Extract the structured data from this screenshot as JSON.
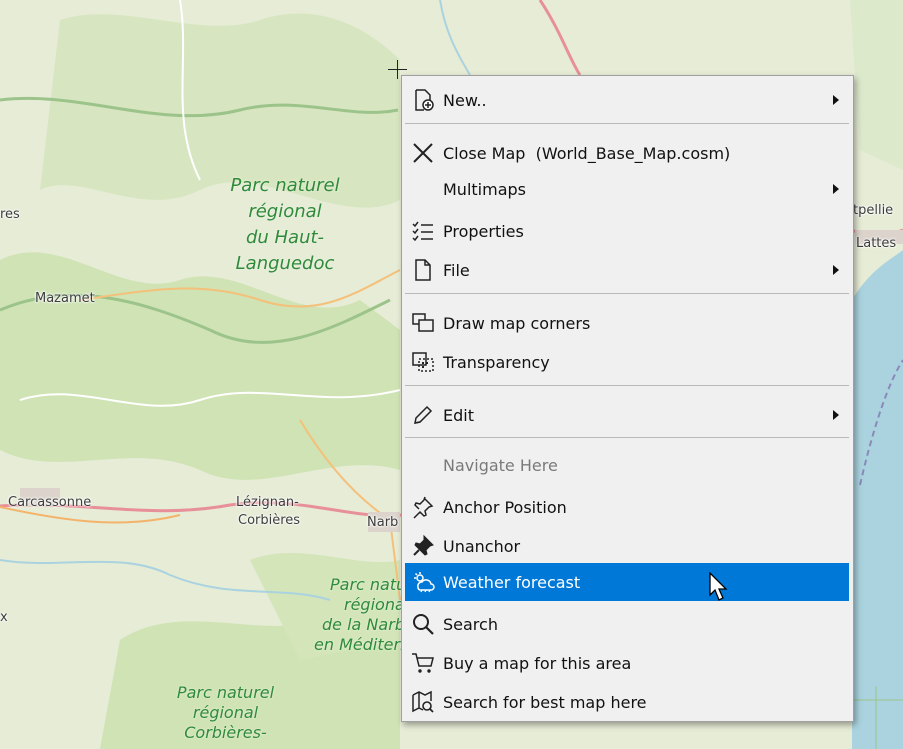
{
  "map": {
    "places": [
      "Mazamet",
      "Carcassonne",
      "Lézignan-",
      "Corbières",
      "Narb",
      "Lattes",
      "tpellie",
      "res",
      "x"
    ],
    "parks": [
      {
        "lines": [
          "Parc naturel",
          "régional",
          "du Haut-",
          "Languedoc"
        ]
      },
      {
        "lines": [
          "Parc natu",
          "régiona",
          "de la Narbo",
          "en Méditerr"
        ]
      },
      {
        "lines": [
          "Parc naturel",
          "régional",
          "Corbières-"
        ]
      }
    ]
  },
  "menu": {
    "items": [
      {
        "label": "New..",
        "icon": "new-map-icon",
        "submenu": true
      },
      {
        "label": "Close Map  (World_Base_Map.cosm)",
        "icon": "close-icon",
        "submenu": false
      },
      {
        "label": "Multimaps",
        "icon": "",
        "submenu": true
      },
      {
        "label": "Properties",
        "icon": "properties-list-icon",
        "submenu": false
      },
      {
        "label": "File",
        "icon": "file-icon",
        "submenu": true
      },
      {
        "label": "Draw map corners",
        "icon": "map-corners-icon",
        "submenu": false
      },
      {
        "label": "Transparency",
        "icon": "transparency-icon",
        "submenu": false
      },
      {
        "label": "Edit",
        "icon": "pencil-icon",
        "submenu": true
      },
      {
        "label": "Navigate Here",
        "icon": "",
        "submenu": false,
        "disabled": true
      },
      {
        "label": "Anchor Position",
        "icon": "pin-outline-icon",
        "submenu": false
      },
      {
        "label": "Unanchor",
        "icon": "pin-filled-icon",
        "submenu": false
      },
      {
        "label": "Weather forecast",
        "icon": "weather-icon",
        "submenu": false,
        "highlighted": true
      },
      {
        "label": "Search",
        "icon": "magnifier-icon",
        "submenu": false
      },
      {
        "label": "Buy a map for this area",
        "icon": "cart-icon",
        "submenu": false
      },
      {
        "label": "Search for best map here",
        "icon": "map-search-icon",
        "submenu": false
      }
    ]
  },
  "colors": {
    "highlight": "#0078d7",
    "menu_bg": "#f0f0f0",
    "sea": "#aad3df",
    "park": "#cfe3b4"
  }
}
